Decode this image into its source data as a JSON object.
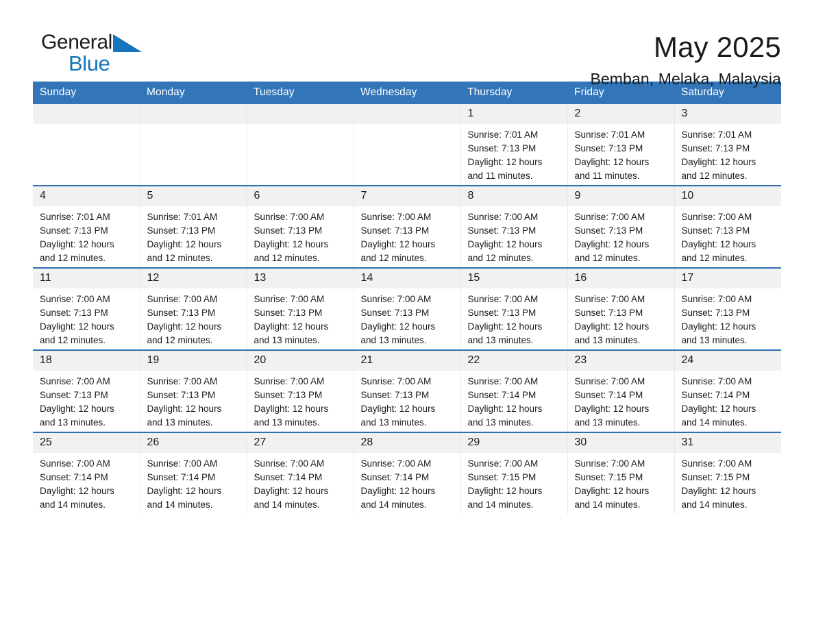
{
  "brand": {
    "word_general": "General",
    "word_blue": "Blue",
    "flag_icon": "blue-triangle-icon",
    "accent_color": "#1574bb"
  },
  "header": {
    "title": "May 2025",
    "location": "Bemban, Melaka, Malaysia"
  },
  "calendar": {
    "header_bg": "#3275b8",
    "row_divider_color": "#2f6fae",
    "daynum_bg": "#f1f1f1",
    "weekday_headers": [
      "Sunday",
      "Monday",
      "Tuesday",
      "Wednesday",
      "Thursday",
      "Friday",
      "Saturday"
    ],
    "weeks": [
      [
        {
          "day": "",
          "empty": true
        },
        {
          "day": "",
          "empty": true
        },
        {
          "day": "",
          "empty": true
        },
        {
          "day": "",
          "empty": true
        },
        {
          "day": "1",
          "sunrise": "Sunrise: 7:01 AM",
          "sunset": "Sunset: 7:13 PM",
          "daylight_line1": "Daylight: 12 hours",
          "daylight_line2": "and 11 minutes."
        },
        {
          "day": "2",
          "sunrise": "Sunrise: 7:01 AM",
          "sunset": "Sunset: 7:13 PM",
          "daylight_line1": "Daylight: 12 hours",
          "daylight_line2": "and 11 minutes."
        },
        {
          "day": "3",
          "sunrise": "Sunrise: 7:01 AM",
          "sunset": "Sunset: 7:13 PM",
          "daylight_line1": "Daylight: 12 hours",
          "daylight_line2": "and 12 minutes."
        }
      ],
      [
        {
          "day": "4",
          "sunrise": "Sunrise: 7:01 AM",
          "sunset": "Sunset: 7:13 PM",
          "daylight_line1": "Daylight: 12 hours",
          "daylight_line2": "and 12 minutes."
        },
        {
          "day": "5",
          "sunrise": "Sunrise: 7:01 AM",
          "sunset": "Sunset: 7:13 PM",
          "daylight_line1": "Daylight: 12 hours",
          "daylight_line2": "and 12 minutes."
        },
        {
          "day": "6",
          "sunrise": "Sunrise: 7:00 AM",
          "sunset": "Sunset: 7:13 PM",
          "daylight_line1": "Daylight: 12 hours",
          "daylight_line2": "and 12 minutes."
        },
        {
          "day": "7",
          "sunrise": "Sunrise: 7:00 AM",
          "sunset": "Sunset: 7:13 PM",
          "daylight_line1": "Daylight: 12 hours",
          "daylight_line2": "and 12 minutes."
        },
        {
          "day": "8",
          "sunrise": "Sunrise: 7:00 AM",
          "sunset": "Sunset: 7:13 PM",
          "daylight_line1": "Daylight: 12 hours",
          "daylight_line2": "and 12 minutes."
        },
        {
          "day": "9",
          "sunrise": "Sunrise: 7:00 AM",
          "sunset": "Sunset: 7:13 PM",
          "daylight_line1": "Daylight: 12 hours",
          "daylight_line2": "and 12 minutes."
        },
        {
          "day": "10",
          "sunrise": "Sunrise: 7:00 AM",
          "sunset": "Sunset: 7:13 PM",
          "daylight_line1": "Daylight: 12 hours",
          "daylight_line2": "and 12 minutes."
        }
      ],
      [
        {
          "day": "11",
          "sunrise": "Sunrise: 7:00 AM",
          "sunset": "Sunset: 7:13 PM",
          "daylight_line1": "Daylight: 12 hours",
          "daylight_line2": "and 12 minutes."
        },
        {
          "day": "12",
          "sunrise": "Sunrise: 7:00 AM",
          "sunset": "Sunset: 7:13 PM",
          "daylight_line1": "Daylight: 12 hours",
          "daylight_line2": "and 12 minutes."
        },
        {
          "day": "13",
          "sunrise": "Sunrise: 7:00 AM",
          "sunset": "Sunset: 7:13 PM",
          "daylight_line1": "Daylight: 12 hours",
          "daylight_line2": "and 13 minutes."
        },
        {
          "day": "14",
          "sunrise": "Sunrise: 7:00 AM",
          "sunset": "Sunset: 7:13 PM",
          "daylight_line1": "Daylight: 12 hours",
          "daylight_line2": "and 13 minutes."
        },
        {
          "day": "15",
          "sunrise": "Sunrise: 7:00 AM",
          "sunset": "Sunset: 7:13 PM",
          "daylight_line1": "Daylight: 12 hours",
          "daylight_line2": "and 13 minutes."
        },
        {
          "day": "16",
          "sunrise": "Sunrise: 7:00 AM",
          "sunset": "Sunset: 7:13 PM",
          "daylight_line1": "Daylight: 12 hours",
          "daylight_line2": "and 13 minutes."
        },
        {
          "day": "17",
          "sunrise": "Sunrise: 7:00 AM",
          "sunset": "Sunset: 7:13 PM",
          "daylight_line1": "Daylight: 12 hours",
          "daylight_line2": "and 13 minutes."
        }
      ],
      [
        {
          "day": "18",
          "sunrise": "Sunrise: 7:00 AM",
          "sunset": "Sunset: 7:13 PM",
          "daylight_line1": "Daylight: 12 hours",
          "daylight_line2": "and 13 minutes."
        },
        {
          "day": "19",
          "sunrise": "Sunrise: 7:00 AM",
          "sunset": "Sunset: 7:13 PM",
          "daylight_line1": "Daylight: 12 hours",
          "daylight_line2": "and 13 minutes."
        },
        {
          "day": "20",
          "sunrise": "Sunrise: 7:00 AM",
          "sunset": "Sunset: 7:13 PM",
          "daylight_line1": "Daylight: 12 hours",
          "daylight_line2": "and 13 minutes."
        },
        {
          "day": "21",
          "sunrise": "Sunrise: 7:00 AM",
          "sunset": "Sunset: 7:13 PM",
          "daylight_line1": "Daylight: 12 hours",
          "daylight_line2": "and 13 minutes."
        },
        {
          "day": "22",
          "sunrise": "Sunrise: 7:00 AM",
          "sunset": "Sunset: 7:14 PM",
          "daylight_line1": "Daylight: 12 hours",
          "daylight_line2": "and 13 minutes."
        },
        {
          "day": "23",
          "sunrise": "Sunrise: 7:00 AM",
          "sunset": "Sunset: 7:14 PM",
          "daylight_line1": "Daylight: 12 hours",
          "daylight_line2": "and 13 minutes."
        },
        {
          "day": "24",
          "sunrise": "Sunrise: 7:00 AM",
          "sunset": "Sunset: 7:14 PM",
          "daylight_line1": "Daylight: 12 hours",
          "daylight_line2": "and 14 minutes."
        }
      ],
      [
        {
          "day": "25",
          "sunrise": "Sunrise: 7:00 AM",
          "sunset": "Sunset: 7:14 PM",
          "daylight_line1": "Daylight: 12 hours",
          "daylight_line2": "and 14 minutes."
        },
        {
          "day": "26",
          "sunrise": "Sunrise: 7:00 AM",
          "sunset": "Sunset: 7:14 PM",
          "daylight_line1": "Daylight: 12 hours",
          "daylight_line2": "and 14 minutes."
        },
        {
          "day": "27",
          "sunrise": "Sunrise: 7:00 AM",
          "sunset": "Sunset: 7:14 PM",
          "daylight_line1": "Daylight: 12 hours",
          "daylight_line2": "and 14 minutes."
        },
        {
          "day": "28",
          "sunrise": "Sunrise: 7:00 AM",
          "sunset": "Sunset: 7:14 PM",
          "daylight_line1": "Daylight: 12 hours",
          "daylight_line2": "and 14 minutes."
        },
        {
          "day": "29",
          "sunrise": "Sunrise: 7:00 AM",
          "sunset": "Sunset: 7:15 PM",
          "daylight_line1": "Daylight: 12 hours",
          "daylight_line2": "and 14 minutes."
        },
        {
          "day": "30",
          "sunrise": "Sunrise: 7:00 AM",
          "sunset": "Sunset: 7:15 PM",
          "daylight_line1": "Daylight: 12 hours",
          "daylight_line2": "and 14 minutes."
        },
        {
          "day": "31",
          "sunrise": "Sunrise: 7:00 AM",
          "sunset": "Sunset: 7:15 PM",
          "daylight_line1": "Daylight: 12 hours",
          "daylight_line2": "and 14 minutes."
        }
      ]
    ]
  }
}
